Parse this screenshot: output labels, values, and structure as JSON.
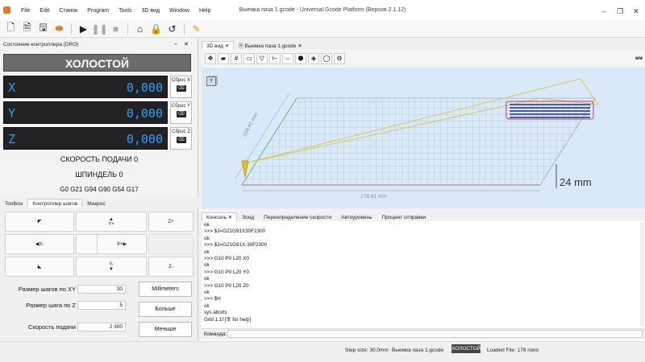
{
  "app": {
    "title": "Выемка паза 1.gcode - Universal Gcode Platform (Версия 2.1.12)"
  },
  "menu": [
    "File",
    "Edit",
    "Станок",
    "Program",
    "Tools",
    "3D вид",
    "Window",
    "Help"
  ],
  "dro": {
    "title": "Состояние контроллера (DRO)",
    "state": "ХОЛОСТОЙ",
    "axes": [
      {
        "name": "X",
        "value": "0,000",
        "reset": "Сброс X"
      },
      {
        "name": "Y",
        "value": "0,000",
        "reset": "Сброс Y"
      },
      {
        "name": "Z",
        "value": "0,000",
        "reset": "Сброс Z"
      }
    ],
    "feed_label": "СКОРОСТЬ ПОДАЧИ",
    "feed_value": "0",
    "spindle_label": "ШПИНДЕЛЬ",
    "spindle_value": "0",
    "gcode_state": "G0 G21 G94 G90 G54 G17"
  },
  "lefttabs": [
    "Toolbox",
    "Контроллер шагов",
    "Макрос"
  ],
  "jog": {
    "buttons": {
      "ul": "◤",
      "yplus": "Y+",
      "zplus": "Z+",
      "xminus": "X-",
      "center": "⌨",
      "xplus": "X+",
      "dl": "◣",
      "yminus": "Y-",
      "dr": "◢",
      "zminus": "Z-"
    },
    "step_xy_label": "Размер шагов по XY",
    "step_xy": "30",
    "step_z_label": "Размер шага по Z",
    "step_z": "5",
    "feed_label": "Скорость подачи",
    "feed": "2 300",
    "mm": "Millimeters",
    "more": "Больше",
    "less": "Меньше"
  },
  "viewtabs": [
    "3D вид",
    "Выемка паза 1.gcode"
  ],
  "view": {
    "w_label": "178.41 mm",
    "h_label": "104.41 mm",
    "z_label": "24 mm",
    "mm": "мм"
  },
  "consoletabs": [
    "Консоль",
    "Зонд",
    "Переопределение скорости",
    "Автоуровень",
    "Процент отправки"
  ],
  "console": [
    "ok",
    ">>> $J=G21G91X30F2300",
    "ok",
    ">>> $J=G21G91X-30F2300",
    "ok",
    ">>> G10 P0 L20 X0",
    "ok",
    ">>> G10 P0 L20 Y0",
    "ok",
    ">>> G10 P0 L20 Z0",
    "ok",
    ">>> $H",
    "ok",
    "sys.aborts",
    "Grbl 1.1f ['$' for help]"
  ],
  "cmd_label": "Команда:",
  "status": {
    "step": "Step size: 30.0mm",
    "file": "Выемка паза 1.gcode",
    "state": "ХОЛОСТОЙ",
    "loaded": "Loaded File: 178 rows"
  },
  "colors": {
    "dro_bg": "#222222",
    "dro_text": "#2aa0ff",
    "state_bg": "#6b6b6b",
    "view_bg": "#d8eaf8"
  }
}
